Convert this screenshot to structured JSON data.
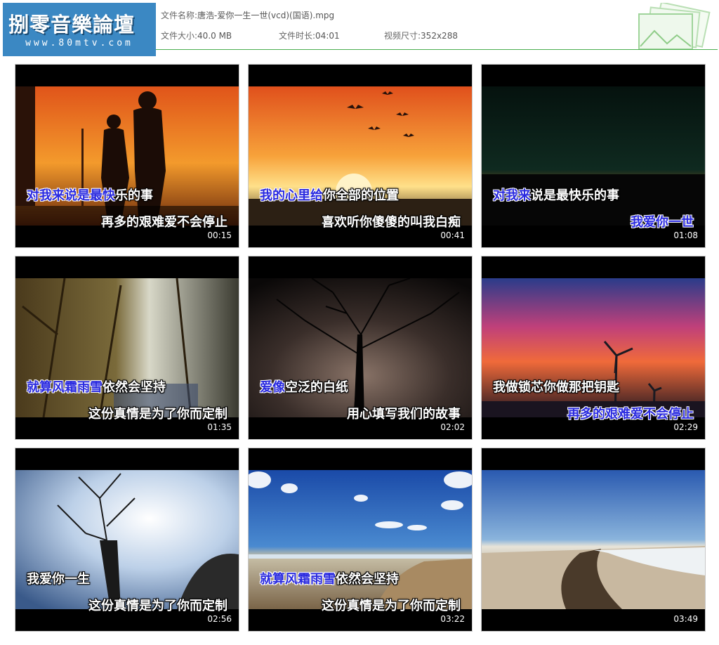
{
  "header": {
    "logo_title": "捌零音樂論壇",
    "logo_url": "www.80mtv.com",
    "file_name_label": "文件名称:",
    "file_name": "唐浩-爱你一生一世(vcd)(国语).mpg",
    "file_size_label": "文件大小:",
    "file_size": "40.0 MB",
    "duration_label": "文件时长:",
    "duration": "04:01",
    "dimensions_label": "视频尺寸:",
    "dimensions": "352x288"
  },
  "thumbnails": [
    {
      "line1_hl": "对我来说是最快",
      "line1": "乐的事",
      "line2_hl": "",
      "line2": "再多的艰难爱不会停止",
      "time": "00:15",
      "scene": "sunset-couple"
    },
    {
      "line1_hl": "我的心里给",
      "line1": "你全部的位置",
      "line2_hl": "",
      "line2": "喜欢听你傻傻的叫我白痴",
      "time": "00:41",
      "scene": "sunset-birds"
    },
    {
      "line1_hl": "对我来",
      "line1": "说是最快乐的事",
      "line2_hl": "我爱你一世",
      "line2": "",
      "time": "01:08",
      "scene": "dusk-dark"
    },
    {
      "line1_hl": "就算风霜雨雪",
      "line1": "依然会坚持",
      "line2_hl": "",
      "line2": "这份真情是为了你而定制",
      "time": "01:35",
      "scene": "forest"
    },
    {
      "line1_hl": "爱像",
      "line1": "空泛的白纸",
      "line2_hl": "",
      "line2": "用心填写我们的故事",
      "time": "02:02",
      "scene": "tree-silhouette"
    },
    {
      "line1_hl": "",
      "line1": "我做锁芯你做那把钥匙",
      "line2_hl": "再多的艰难爱不会停止",
      "line2": "",
      "time": "02:29",
      "scene": "windmill-sunset"
    },
    {
      "line1_hl": "",
      "line1": "我爱你一生",
      "line2_hl": "",
      "line2": "这份真情是为了你而定制",
      "time": "02:56",
      "scene": "bare-tree-sky"
    },
    {
      "line1_hl": "就算风霜雨雪",
      "line1": "依然会坚持",
      "line2_hl": "",
      "line2": "这份真情是为了你而定制",
      "time": "03:22",
      "scene": "beach-clouds"
    },
    {
      "line1_hl": "",
      "line1": "",
      "line2_hl": "",
      "line2": "",
      "time": "03:49",
      "scene": "beach-river"
    }
  ]
}
